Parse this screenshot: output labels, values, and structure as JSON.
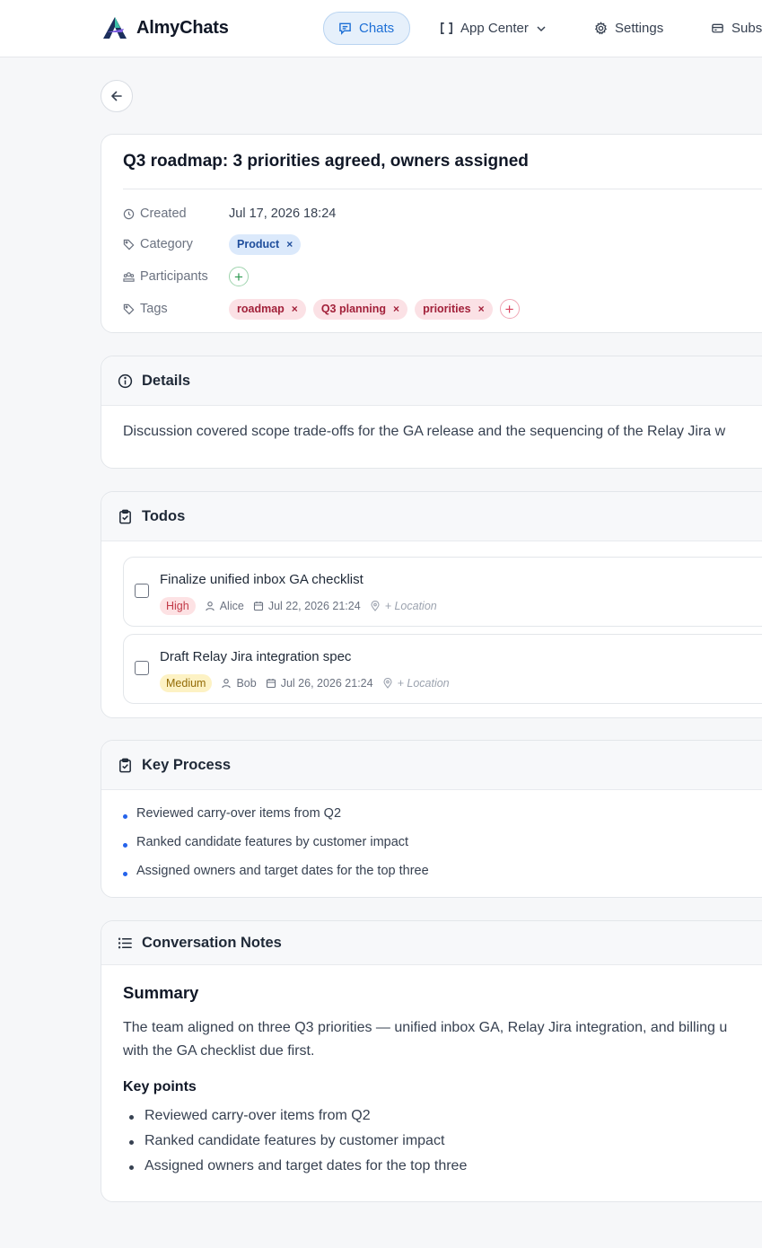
{
  "app": {
    "name": "AlmyChats"
  },
  "nav": {
    "chats": "Chats",
    "app_center": "App Center",
    "settings": "Settings",
    "subscription": "Subs"
  },
  "conversation": {
    "title": "Q3 roadmap: 3 priorities agreed, owners assigned",
    "created_label": "Created",
    "created_value": "Jul 17, 2026 18:24",
    "category_label": "Category",
    "category_value": "Product",
    "participants_label": "Participants",
    "tags_label": "Tags",
    "tags": [
      "roadmap",
      "Q3 planning",
      "priorities"
    ]
  },
  "details": {
    "title": "Details",
    "text": "Discussion covered scope trade-offs for the GA release and the sequencing of the Relay Jira w"
  },
  "todos": {
    "title": "Todos",
    "items": [
      {
        "title": "Finalize unified inbox GA checklist",
        "priority": "High",
        "assignee": "Alice",
        "due": "Jul 22, 2026 21:24",
        "location": "+ Location"
      },
      {
        "title": "Draft Relay Jira integration spec",
        "priority": "Medium",
        "assignee": "Bob",
        "due": "Jul 26, 2026 21:24",
        "location": "+ Location"
      }
    ]
  },
  "key_process": {
    "title": "Key Process",
    "items": [
      "Reviewed carry-over items from Q2",
      "Ranked candidate features by customer impact",
      "Assigned owners and target dates for the top three"
    ]
  },
  "notes": {
    "title": "Conversation Notes",
    "summary_heading": "Summary",
    "summary_text": "The team aligned on three Q3 priorities — unified inbox GA, Relay Jira integration, and billing u with the GA checklist due first.",
    "summary_line1": "The team aligned on three Q3 priorities — unified inbox GA, Relay Jira integration, and billing u",
    "summary_line2": "with the GA checklist due first.",
    "key_points_heading": "Key points",
    "key_points": [
      "Reviewed carry-over items from Q2",
      "Ranked candidate features by customer impact",
      "Assigned owners and target dates for the top three"
    ]
  },
  "colors": {
    "accent": "#1d6fd6",
    "high_priority": "#c23a48",
    "medium_priority": "#936b06",
    "tag_red": "#a2213a",
    "category_blue": "#1f4e9c"
  }
}
